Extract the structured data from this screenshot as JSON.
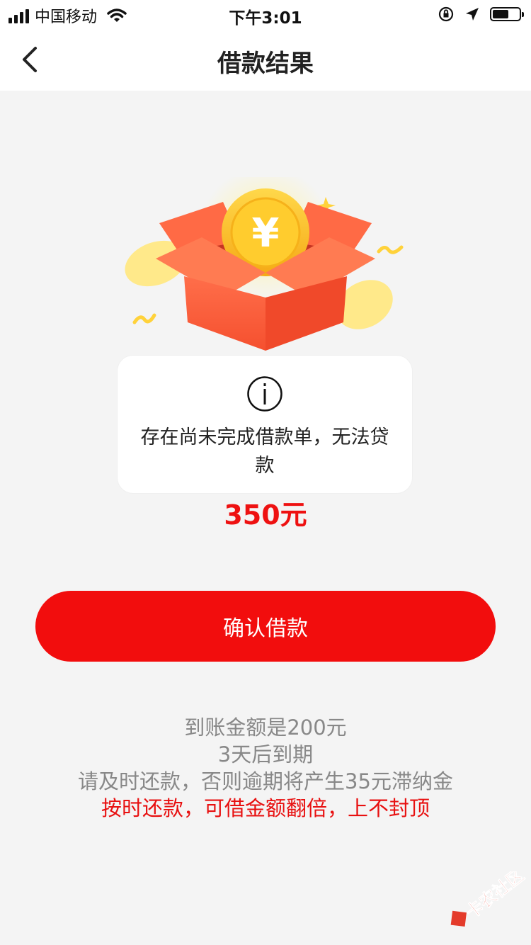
{
  "status_bar": {
    "carrier": "中国移动",
    "time": "下午3:01"
  },
  "nav": {
    "title": "借款结果"
  },
  "toast": {
    "message": "存在尚未完成借款单，无法贷款"
  },
  "amount": "350元",
  "confirm_button": "确认借款",
  "info": {
    "line1": "到账金额是200元",
    "line2": "3天后到期",
    "line3": "请及时还款，否则逾期将产生35元滞纳金",
    "line4": "按时还款，可借金额翻倍，上不封顶"
  },
  "watermark": {
    "text": "卡农社区"
  },
  "colors": {
    "accent": "#f20d0d",
    "amount": "#ee1111",
    "info_text": "#888888",
    "background": "#f4f4f4"
  },
  "icons": [
    "signal-icon",
    "wifi-icon",
    "orientation-lock-icon",
    "location-icon",
    "battery-icon",
    "back-arrow-icon",
    "gift-box-coin-icon",
    "info-icon"
  ]
}
